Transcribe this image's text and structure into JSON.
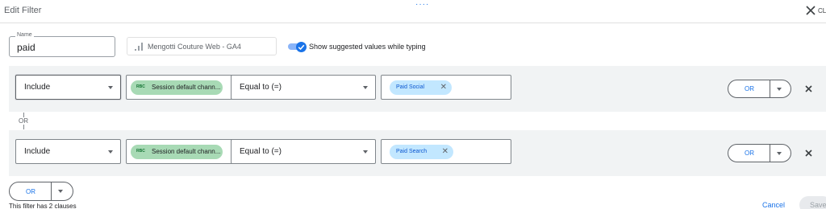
{
  "header": {
    "title": "Edit Filter",
    "drag_handle": "····",
    "close_label": "CL"
  },
  "name_field": {
    "label": "Name",
    "value": "paid"
  },
  "property": {
    "icon": "analytics-bars-icon",
    "name": "Mengotti Couture Web - GA4"
  },
  "suggest_toggle": {
    "on": true,
    "label": "Show suggested values while typing"
  },
  "clauses": [
    {
      "include": "Include",
      "dimension_badge": "RBC",
      "dimension": "Session default chann...",
      "operator": "Equal to (=)",
      "value_chip": "Paid Social",
      "or_label": "OR"
    },
    {
      "include": "Include",
      "dimension_badge": "RBC",
      "dimension": "Session default chann...",
      "operator": "Equal to (=)",
      "value_chip": "Paid Search",
      "or_label": "OR"
    }
  ],
  "connector": {
    "label": "OR"
  },
  "add_or": {
    "label": "OR"
  },
  "footer": {
    "clause_count_text": "This filter has 2 clauses",
    "cancel": "Cancel",
    "save": "Save"
  },
  "colors": {
    "accent": "#1a73e8",
    "dimension_chip": "#a8dab5",
    "value_chip": "#c2e7ff",
    "clause_bg": "#f1f3f4"
  }
}
